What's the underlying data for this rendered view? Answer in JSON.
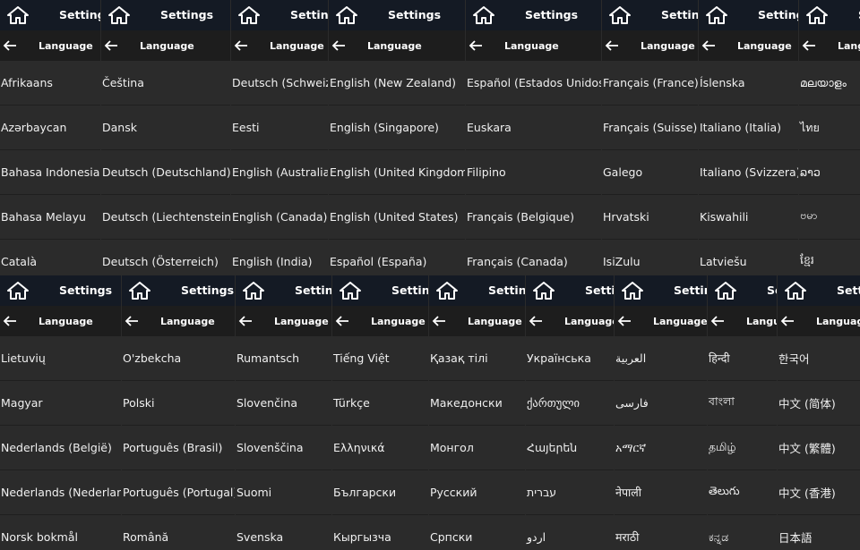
{
  "settings_title": "Settings",
  "language_title": "Language",
  "colors": {
    "topbar": "#141a24",
    "subbar": "#1d1d1d",
    "list_bg": "#2b2b2b"
  },
  "icons": {
    "home": "home-icon",
    "back": "arrow-left-icon"
  },
  "top_panels": [
    {
      "items": [
        "Afrikaans",
        "Azərbaycan",
        "Bahasa Indonesia",
        "Bahasa Melayu",
        "Català"
      ]
    },
    {
      "items": [
        "Čeština",
        "Dansk",
        "Deutsch (Deutschland)",
        "Deutsch (Liechtenstein)",
        "Deutsch (Österreich)"
      ]
    },
    {
      "items": [
        "Deutsch (Schweiz)",
        "Eesti",
        "English (Australia)",
        "English (Canada)",
        "English (India)"
      ]
    },
    {
      "items": [
        "English (New Zealand)",
        "English (Singapore)",
        "English (United Kingdom)",
        "English (United States)",
        "Español (España)"
      ]
    },
    {
      "items": [
        "Español (Estados Unidos)",
        "Euskara",
        "Filipino",
        "Français (Belgique)",
        "Français (Canada)"
      ]
    },
    {
      "items": [
        "Français (France)",
        "Français (Suisse)",
        "Galego",
        "Hrvatski",
        "IsiZulu"
      ]
    },
    {
      "items": [
        "Íslenska",
        "Italiano (Italia)",
        "Italiano (Svizzera)",
        "Kiswahili",
        "Latviešu"
      ]
    },
    {
      "items": [
        "മലയാളം",
        "ไทย",
        "ລາວ",
        "ဗမာ",
        "ខ្មែរ"
      ]
    }
  ],
  "bottom_panels": [
    {
      "items": [
        "Lietuvių",
        "Magyar",
        "Nederlands (België)",
        "Nederlands (Nederland)",
        "Norsk bokmål"
      ]
    },
    {
      "items": [
        "O'zbekcha",
        "Polski",
        "Português (Brasil)",
        "Português (Portugal)",
        "Română"
      ]
    },
    {
      "items": [
        "Rumantsch",
        "Slovenčina",
        "Slovenščina",
        "Suomi",
        "Svenska"
      ]
    },
    {
      "items": [
        "Tiếng Việt",
        "Türkçe",
        "Ελληνικά",
        "Български",
        "Кыргызча"
      ]
    },
    {
      "items": [
        "Қазақ тілі",
        "Македонски",
        "Монгол",
        "Русский",
        "Српски"
      ]
    },
    {
      "items": [
        "Українська",
        "ქართული",
        "Հայերեն",
        "עברית",
        "اردو"
      ]
    },
    {
      "items": [
        "العربية",
        "فارسی",
        "አማርኛ",
        "नेपाली",
        "मराठी"
      ]
    },
    {
      "items": [
        "हिन्दी",
        "বাংলা",
        "தமிழ்",
        "తెలుగు",
        "ಕನ್ನಡ"
      ]
    },
    {
      "items": [
        "한국어",
        "中文 (简体)",
        "中文 (繁體)",
        "中文 (香港)",
        "日本語"
      ]
    }
  ]
}
